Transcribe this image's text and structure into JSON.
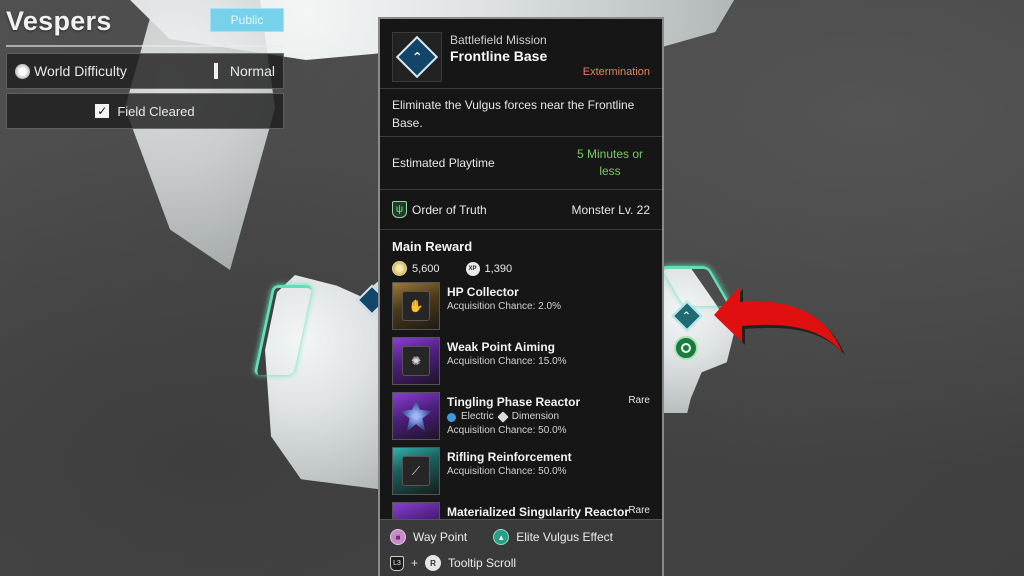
{
  "region": {
    "name": "Vespers",
    "visibility_badge": "Public",
    "world_difficulty_label": "World Difficulty",
    "world_difficulty_value": "Normal",
    "field_status": "Field Cleared",
    "field_cleared": true
  },
  "tooltip": {
    "mission_type": "Battlefield Mission",
    "mission_name": "Frontline Base",
    "mission_category": "Extermination",
    "description": "Eliminate the Vulgus forces near the Frontline Base.",
    "playtime_label": "Estimated Playtime",
    "playtime_value": "5 Minutes or less",
    "faction_name": "Order of Truth",
    "monster_level": "Monster Lv. 22",
    "reward_title": "Main Reward",
    "currency": [
      {
        "icon": "gold-coin-icon",
        "value": "5,600"
      },
      {
        "icon": "xp-icon",
        "value": "1,390"
      }
    ],
    "rewards": [
      {
        "name": "HP Collector",
        "chance": "Acquisition Chance: 2.0%",
        "rarity": "",
        "tier": "gold",
        "attributes": []
      },
      {
        "name": "Weak Point Aiming",
        "chance": "Acquisition Chance: 15.0%",
        "rarity": "",
        "tier": "purple",
        "attributes": []
      },
      {
        "name": "Tingling Phase Reactor",
        "chance": "Acquisition Chance: 50.0%",
        "rarity": "Rare",
        "tier": "purple",
        "attributes": [
          "Electric",
          "Dimension"
        ]
      },
      {
        "name": "Rifling Reinforcement",
        "chance": "Acquisition Chance: 50.0%",
        "rarity": "",
        "tier": "teal",
        "attributes": []
      },
      {
        "name": "Materialized Singularity Reactor",
        "chance": "",
        "rarity": "Rare",
        "tier": "purple",
        "attributes": []
      }
    ],
    "footer": {
      "waypoint_label": "Way Point",
      "elite_label": "Elite Vulgus Effect",
      "scroll_button_l": "L3",
      "scroll_button_r": "R",
      "scroll_plus": "+",
      "scroll_label": "Tooltip Scroll"
    }
  },
  "colors": {
    "accent_teal": "#5fe0b8",
    "category_orange": "#e0835a",
    "playtime_green": "#7cc86a",
    "public_badge": "#6fd0ec",
    "arrow_red": "#e01010"
  }
}
